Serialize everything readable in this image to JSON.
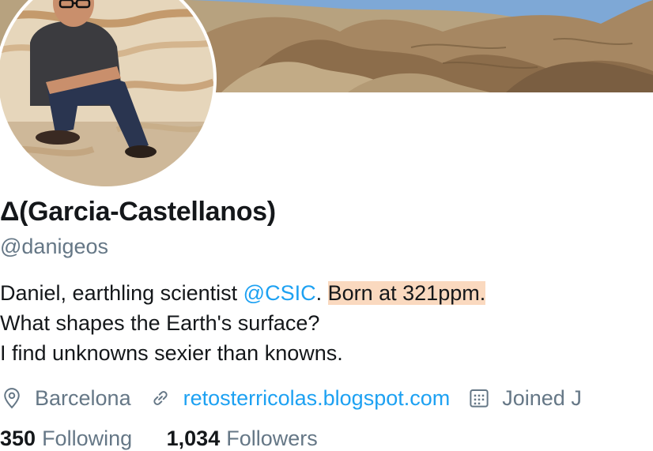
{
  "profile": {
    "display_name": "Δ(Garcia-Castellanos)",
    "handle": "@danigeos",
    "bio": {
      "line1_text": "Daniel, earthling scientist ",
      "line1_mention": "@CSIC",
      "line1_punct": ". ",
      "line1_highlight": "Born at 321ppm.",
      "line2": "What shapes the Earth's surface?",
      "line3": "I find unknowns sexier than knowns."
    },
    "location": "Barcelona",
    "website": "retosterricolas.blogspot.com",
    "joined": "Joined J",
    "following_count": "350",
    "following_label": "Following",
    "followers_count": "1,034",
    "followers_label": "Followers"
  },
  "icons": {
    "location": "location-pin-icon",
    "link": "link-icon",
    "calendar": "calendar-icon"
  },
  "colors": {
    "link": "#1da1f2",
    "muted": "#657786",
    "text": "#14171a",
    "highlight": "#fad9bf"
  }
}
